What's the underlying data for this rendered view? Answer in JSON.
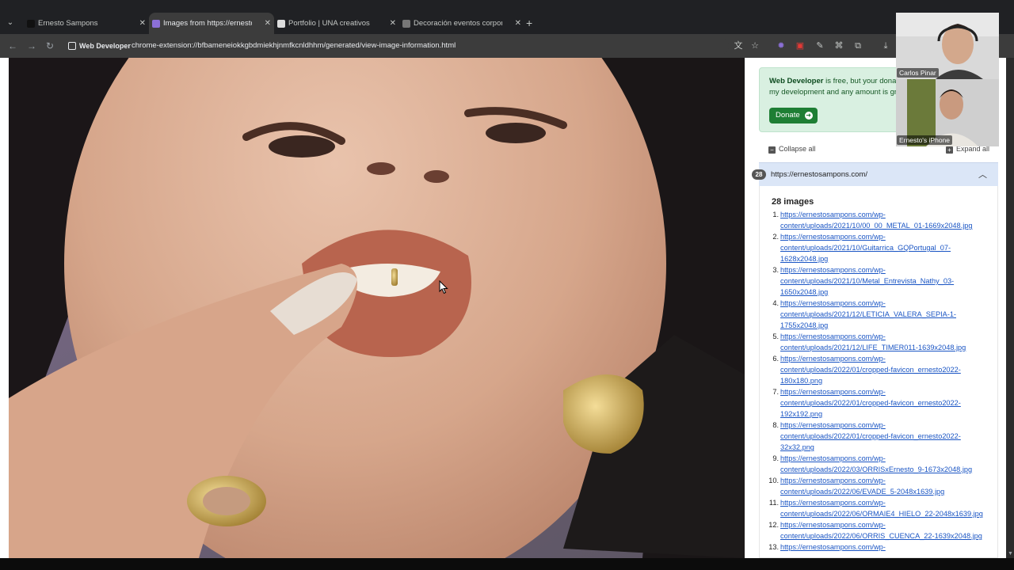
{
  "tabs": [
    {
      "title": "Ernesto Sampons",
      "favicon_color": "#111111",
      "active": false
    },
    {
      "title": "Images from https://ernestosampons.com/",
      "favicon_color": "#8b6fd6",
      "active": true
    },
    {
      "title": "Portfolio | UNA creativos",
      "favicon_color": "#dddddd",
      "active": false
    },
    {
      "title": "Decoración eventos corporativos",
      "favicon_color": "#777777",
      "active": false
    }
  ],
  "toolbar": {
    "chip_label": "Web Developer",
    "url": "chrome-extension://bfbameneiokkgbdmiekhjnmfkcnldhhm/generated/view-image-information.html"
  },
  "notice": {
    "brand": "Web Developer",
    "text_1": " is free, but your donat",
    "text_2": "my development and any amount is gr",
    "donate_label": "Donate"
  },
  "controls": {
    "collapse_all": "Collapse all",
    "expand_all": "Expand all"
  },
  "site": {
    "count": "28",
    "url": "https://ernestosampons.com/"
  },
  "images_heading": "28 images",
  "images": [
    {
      "n": "1.",
      "line1": "https://ernestosampons.com/wp-",
      "line2": "content/uploads/2021/10/00_00_METAL_01-1669x2048.jpg",
      "line3": ""
    },
    {
      "n": "2.",
      "line1": "https://ernestosampons.com/wp-",
      "line2": "content/uploads/2021/10/Guitarrica_GQPortugal_07-",
      "line3": "1628x2048.jpg"
    },
    {
      "n": "3.",
      "line1": "https://ernestosampons.com/wp-",
      "line2": "content/uploads/2021/10/Metal_Entrevista_Nathy_03-",
      "line3": "1650x2048.jpg"
    },
    {
      "n": "4.",
      "line1": "https://ernestosampons.com/wp-",
      "line2": "content/uploads/2021/12/LETICIA_VALERA_SEPIA-1-",
      "line3": "1755x2048.jpg"
    },
    {
      "n": "5.",
      "line1": "https://ernestosampons.com/wp-",
      "line2": "content/uploads/2021/12/LIFE_TIMER011-1639x2048.jpg",
      "line3": ""
    },
    {
      "n": "6.",
      "line1": "https://ernestosampons.com/wp-",
      "line2": "content/uploads/2022/01/cropped-favicon_ernesto2022-",
      "line3": "180x180.png"
    },
    {
      "n": "7.",
      "line1": "https://ernestosampons.com/wp-",
      "line2": "content/uploads/2022/01/cropped-favicon_ernesto2022-",
      "line3": "192x192.png"
    },
    {
      "n": "8.",
      "line1": "https://ernestosampons.com/wp-",
      "line2": "content/uploads/2022/01/cropped-favicon_ernesto2022-",
      "line3": "32x32.png"
    },
    {
      "n": "9.",
      "line1": "https://ernestosampons.com/wp-",
      "line2": "content/uploads/2022/03/ORRISxErnesto_9-1673x2048.jpg",
      "line3": ""
    },
    {
      "n": "10.",
      "line1": "https://ernestosampons.com/wp-",
      "line2": "content/uploads/2022/06/EVADE_5-2048x1639.jpg",
      "line3": ""
    },
    {
      "n": "11.",
      "line1": "https://ernestosampons.com/wp-",
      "line2": "content/uploads/2022/06/ORMAIE4_HIELO_22-2048x1639.jpg",
      "line3": ""
    },
    {
      "n": "12.",
      "line1": "https://ernestosampons.com/wp-",
      "line2": "content/uploads/2022/06/ORRIS_CUENCA_22-1639x2048.jpg",
      "line3": ""
    },
    {
      "n": "13.",
      "line1": "https://ernestosampons.com/wp-",
      "line2": "",
      "line3": ""
    }
  ],
  "video": {
    "participant_1": "Carlos Pinar",
    "participant_2": "Ernesto's iPhone"
  },
  "colors": {
    "accent_green": "#1e7e34",
    "link_blue": "#1a55c4",
    "site_bar": "#dbe6f7"
  }
}
